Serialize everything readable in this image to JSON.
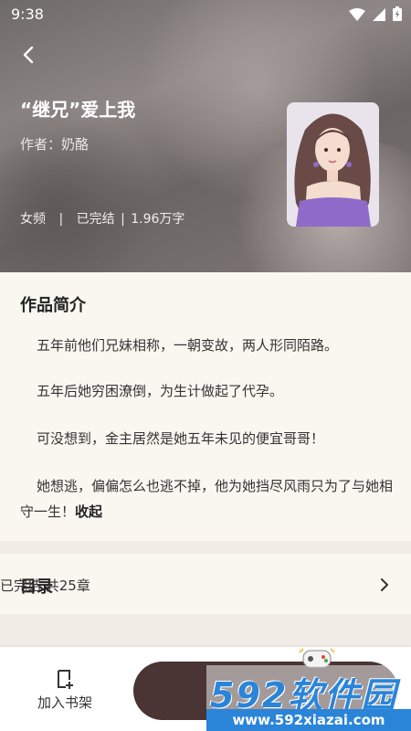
{
  "status_bar": {
    "time": "9:38"
  },
  "book": {
    "title": "“继兄”爱上我",
    "author": "作者：奶酪",
    "channel": "女频",
    "separator": "|",
    "completion": "已完结",
    "word_count": "1.96万字"
  },
  "intro": {
    "heading": "作品简介",
    "paragraphs": [
      "五年前他们兄妹相称，一朝变故，两人形同陌路。",
      "五年后她穷困潦倒，为生计做起了代孕。",
      "可没想到，金主居然是她五年未见的便宜哥哥！",
      "她想逃，偏偏怎么也逃不掉，他为她挡尽风雨只为了与她相守一生！"
    ],
    "collapse_label": "收起"
  },
  "toc": {
    "label": "目录",
    "status": "已完结 共25章"
  },
  "bottom_bar": {
    "add_shelf_label": "加入书架"
  },
  "watermark": {
    "brand": "592软件园",
    "url": "www.592xiazai.com"
  },
  "colors": {
    "page_bg": "#faf7f1",
    "read_button": "#4a3434",
    "watermark_blue": "#2a85d9"
  }
}
